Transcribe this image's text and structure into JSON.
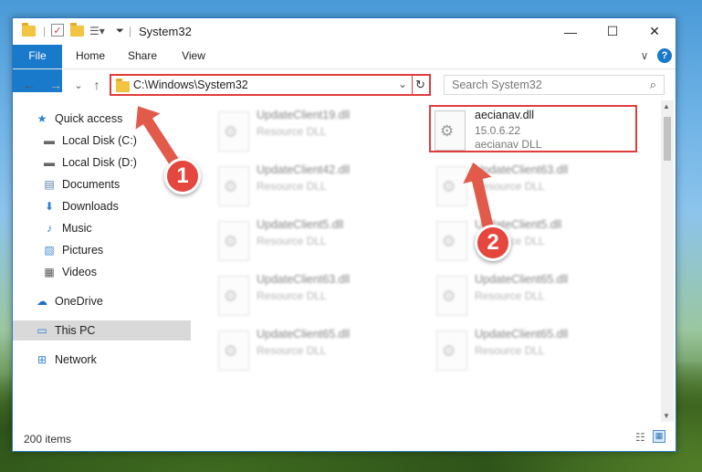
{
  "window": {
    "title": "System32",
    "controls": {
      "minimize": "—",
      "maximize": "☐",
      "close": "✕"
    }
  },
  "ribbon": {
    "tabs": [
      "File",
      "Home",
      "Share",
      "View"
    ],
    "help": "?",
    "expand": "∨"
  },
  "nav": {
    "back": "←",
    "forward": "→",
    "recent": "⌄",
    "up": "↑",
    "address": "C:\\Windows\\System32",
    "dropdown": "⌄",
    "refresh": "↻",
    "search_placeholder": "Search System32"
  },
  "sidebar": {
    "items": [
      {
        "label": "Quick access",
        "icon": "★",
        "pinned": false
      },
      {
        "label": "Local Disk (C:)",
        "icon": "▬",
        "pinned": true
      },
      {
        "label": "Local Disk (D:)",
        "icon": "▬",
        "pinned": false
      },
      {
        "label": "Documents",
        "icon": "▤",
        "pinned": true
      },
      {
        "label": "Downloads",
        "icon": "⬇",
        "pinned": true
      },
      {
        "label": "Music",
        "icon": "♪",
        "pinned": true
      },
      {
        "label": "Pictures",
        "icon": "▧",
        "pinned": true
      },
      {
        "label": "Videos",
        "icon": "▦",
        "pinned": true
      },
      {
        "label": "OneDrive",
        "icon": "☁",
        "pinned": false
      },
      {
        "label": "This PC",
        "icon": "▭",
        "pinned": false
      },
      {
        "label": "Network",
        "icon": "⊞",
        "pinned": false
      }
    ],
    "pin_glyph": "📌"
  },
  "files": {
    "left": [
      {
        "name": "UpdateClient19.dll",
        "type": "Resource DLL"
      },
      {
        "name": "UpdateClient42.dll",
        "type": "Resource DLL"
      },
      {
        "name": "UpdateClient5.dll",
        "type": "Resource DLL"
      },
      {
        "name": "UpdateClient63.dll",
        "type": "Resource DLL"
      },
      {
        "name": "UpdateClient65.dll",
        "type": "Resource DLL"
      }
    ],
    "right": [
      {
        "name": "aecianav.dll",
        "version": "15.0.6.22",
        "type": "aecianav DLL"
      },
      {
        "name": "UpdateClient63.dll",
        "type": "Resource DLL"
      },
      {
        "name": "UpdateClient5.dll",
        "type": "Resource DLL"
      },
      {
        "name": "UpdateClient65.dll",
        "type": "Resource DLL"
      },
      {
        "name": "UpdateClient65.dll",
        "type": "Resource DLL"
      }
    ]
  },
  "status": {
    "item_count": "200 items"
  },
  "annotations": {
    "step1": "1",
    "step2": "2"
  },
  "colors": {
    "accent": "#1979ca",
    "highlight": "#e03c3c",
    "badge": "#e5473f"
  }
}
